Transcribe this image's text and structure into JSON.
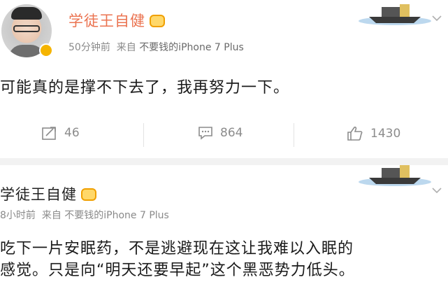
{
  "post1": {
    "author": "学徒王自健",
    "time": "50分钟前",
    "source_prefix": "来自",
    "source": "不要钱的iPhone 7 Plus",
    "text": "可能真的是撑不下去了，我再努力一下。",
    "actions": {
      "repost_count": "46",
      "comment_count": "864",
      "like_count": "1430"
    }
  },
  "post2": {
    "author": "学徒王自健",
    "time": "8小时前",
    "source_prefix": "来自",
    "source": "不要钱的iPhone 7 Plus",
    "text_line1": "吃下一片安眠药，不是逃避现在这让我难以入眠的",
    "text_line2": "感觉。只是向“明天还要早起”这个黑恶势力低头。"
  },
  "colors": {
    "author_highlight": "#eb7350",
    "meta_gray": "#8a8a8a",
    "vip_gold": "#f5b400"
  },
  "icons": [
    "repost-icon",
    "comment-icon",
    "like-icon",
    "crown-icon",
    "boat-icon",
    "chevron-down-icon"
  ]
}
